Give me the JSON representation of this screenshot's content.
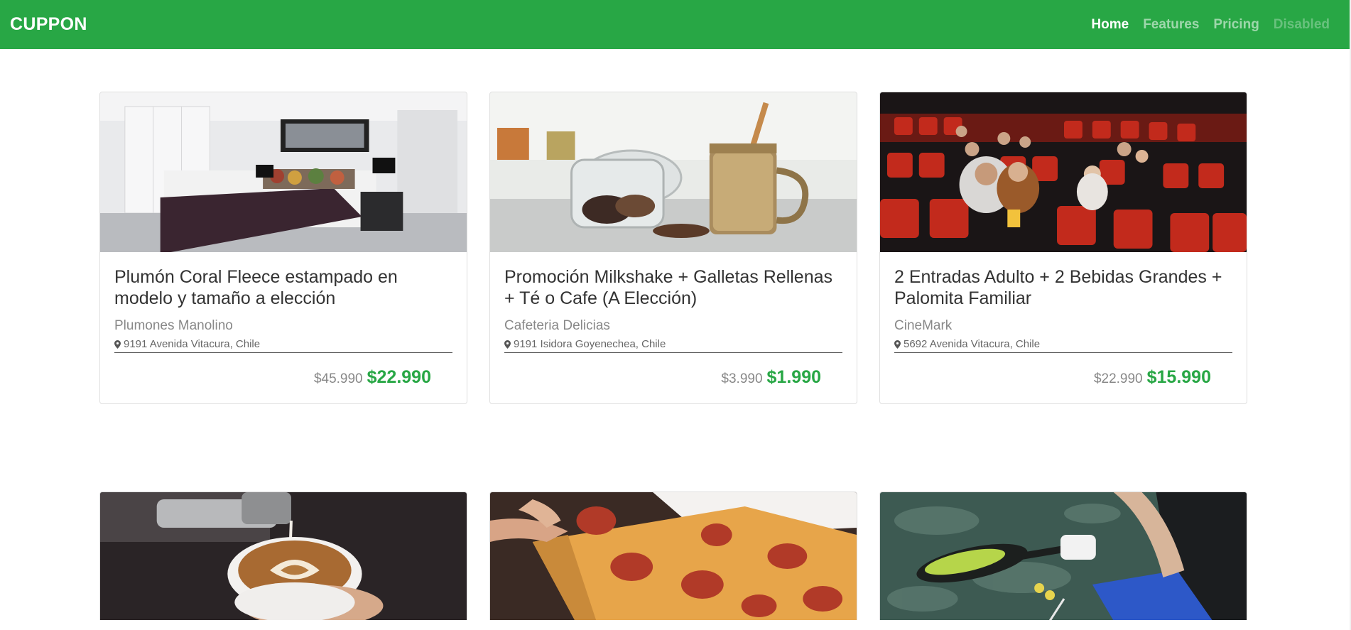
{
  "navbar": {
    "brand": "CUPPON",
    "links": [
      {
        "label": "Home",
        "state": "active"
      },
      {
        "label": "Features",
        "state": "normal"
      },
      {
        "label": "Pricing",
        "state": "normal"
      },
      {
        "label": "Disabled",
        "state": "disabled"
      }
    ]
  },
  "colors": {
    "primary": "#28a745",
    "price": "#28a745"
  },
  "cards": [
    {
      "image": "bedroom-photo",
      "title": "Plumón Coral Fleece estampado en modelo y tamaño a elección",
      "company": "Plumones Manolino",
      "location": "9191 Avenida Vitacura, Chile",
      "old_price": "$45.990",
      "new_price": "$22.990"
    },
    {
      "image": "cookie-jar-milkshake-photo",
      "title": "Promoción Milkshake + Galletas Rellenas + Té o Cafe (A Elección)",
      "company": "Cafeteria Delicias",
      "location": "9191 Isidora Goyenechea, Chile",
      "old_price": "$3.990",
      "new_price": "$1.990"
    },
    {
      "image": "cinema-audience-photo",
      "title": "2 Entradas Adulto + 2 Bebidas Grandes + Palomita Familiar",
      "company": "CineMark",
      "location": "5692 Avenida Vitacura, Chile",
      "old_price": "$22.990",
      "new_price": "$15.990"
    },
    {
      "image": "latte-art-photo"
    },
    {
      "image": "pizza-slice-photo"
    },
    {
      "image": "padel-racket-photo"
    }
  ]
}
